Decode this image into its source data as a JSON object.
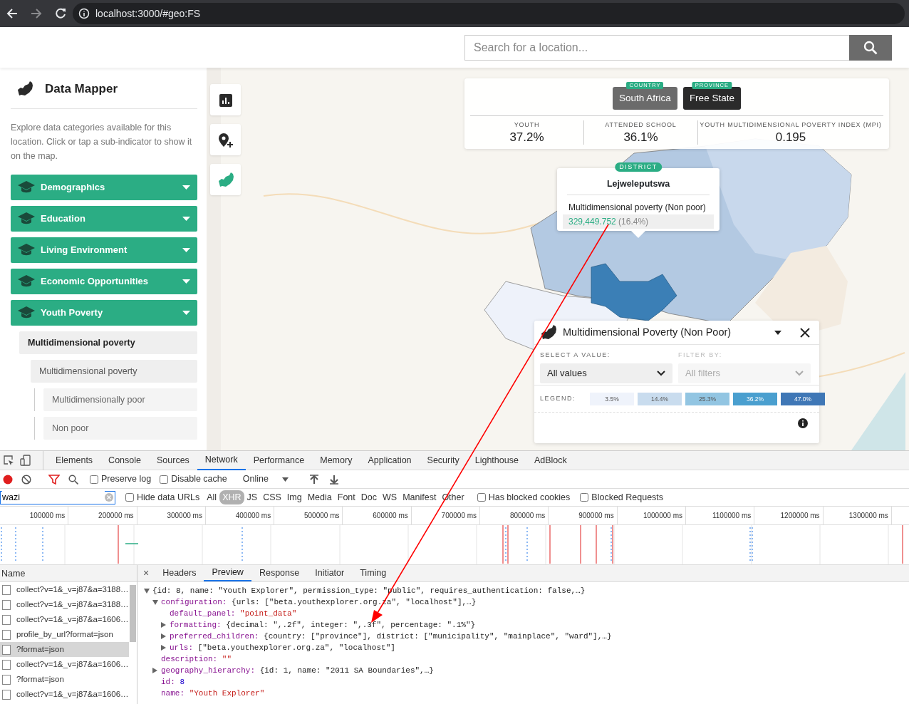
{
  "browser": {
    "url": "localhost:3000/#geo:FS"
  },
  "header": {
    "search_placeholder": "Search for a location..."
  },
  "sidebar": {
    "title": "Data Mapper",
    "description": "Explore data categories available for this location. Click or tap a sub-indicator to show it on the map.",
    "categories": [
      {
        "label": "Demographics"
      },
      {
        "label": "Education"
      },
      {
        "label": "Living Environment"
      },
      {
        "label": "Economic Opportunities"
      },
      {
        "label": "Youth Poverty"
      }
    ],
    "indicators": [
      {
        "label": "Multidimensional poverty",
        "children": [
          {
            "label": "Multidimensional poverty",
            "children": [
              {
                "label": "Multidimensionally poor"
              },
              {
                "label": "Non poor"
              }
            ]
          }
        ]
      }
    ]
  },
  "location": {
    "levels": [
      {
        "tag": "COUNTRY",
        "name": "South Africa",
        "selected": false
      },
      {
        "tag": "PROVINCE",
        "name": "Free State",
        "selected": true
      }
    ],
    "stats": [
      {
        "label": "YOUTH",
        "value": "37.2%"
      },
      {
        "label": "ATTENDED SCHOOL",
        "value": "36.1%"
      },
      {
        "label": "YOUTH MULTIDIMENSIONAL POVERTY INDEX (MPI)",
        "value": "0.195"
      }
    ]
  },
  "tooltip": {
    "tag": "DISTRICT",
    "name": "Lejweleputswa",
    "indicator": "Multidimensional poverty (Non poor)",
    "value": "329,449.752",
    "percentage": "(16.4%)"
  },
  "panel": {
    "title": "Multidimensional Poverty (Non Poor)",
    "select": {
      "label": "SELECT A VALUE:",
      "value": "All values",
      "disabled": false
    },
    "filter": {
      "label": "FILTER BY:",
      "value": "All filters",
      "disabled": true
    },
    "legend_label": "LEGEND:",
    "legend": [
      {
        "label": "3.5%",
        "color": "#eff3fb"
      },
      {
        "label": "14.4%",
        "color": "#c9dcee"
      },
      {
        "label": "25.3%",
        "color": "#92c5e2"
      },
      {
        "label": "36.2%",
        "color": "#4a9fcf"
      },
      {
        "label": "47.0%",
        "color": "#3f77b6"
      }
    ]
  },
  "devtools": {
    "tabs": [
      {
        "label": "Elements",
        "selected": false
      },
      {
        "label": "Console",
        "selected": false
      },
      {
        "label": "Sources",
        "selected": false
      },
      {
        "label": "Network",
        "selected": true
      },
      {
        "label": "Performance",
        "selected": false
      },
      {
        "label": "Memory",
        "selected": false
      },
      {
        "label": "Application",
        "selected": false
      },
      {
        "label": "Security",
        "selected": false
      },
      {
        "label": "Lighthouse",
        "selected": false
      },
      {
        "label": "AdBlock",
        "selected": false
      }
    ],
    "toolbar": {
      "preserve_log": {
        "label": "Preserve log",
        "checked": false
      },
      "disable_cache": {
        "label": "Disable cache",
        "checked": false
      },
      "throttling": "Online"
    },
    "filter": {
      "value": "wazi",
      "hide_data_urls": {
        "label": "Hide data URLs",
        "checked": false
      },
      "types": [
        {
          "label": "All",
          "selected": false
        },
        {
          "label": "XHR",
          "selected": true
        },
        {
          "label": "JS",
          "selected": false
        },
        {
          "label": "CSS",
          "selected": false
        },
        {
          "label": "Img",
          "selected": false
        },
        {
          "label": "Media",
          "selected": false
        },
        {
          "label": "Font",
          "selected": false
        },
        {
          "label": "Doc",
          "selected": false
        },
        {
          "label": "WS",
          "selected": false
        },
        {
          "label": "Manifest",
          "selected": false
        },
        {
          "label": "Other",
          "selected": false
        }
      ],
      "has_blocked_cookies": {
        "label": "Has blocked cookies",
        "checked": false
      },
      "blocked_requests": {
        "label": "Blocked Requests",
        "checked": false
      }
    },
    "timeline_ticks": [
      "100000 ms",
      "200000 ms",
      "300000 ms",
      "400000 ms",
      "500000 ms",
      "600000 ms",
      "700000 ms",
      "800000 ms",
      "900000 ms",
      "1000000 ms",
      "1100000 ms",
      "1200000 ms",
      "1300000 ms"
    ],
    "name_column": "Name",
    "requests": [
      {
        "name": "collect?v=1&_v=j87&a=3188…",
        "selected": false
      },
      {
        "name": "collect?v=1&_v=j87&a=3188…",
        "selected": false
      },
      {
        "name": "collect?v=1&_v=j87&a=1606…",
        "selected": false
      },
      {
        "name": "profile_by_url?format=json",
        "selected": false
      },
      {
        "name": "?format=json",
        "selected": true
      },
      {
        "name": "collect?v=1&_v=j87&a=1606…",
        "selected": false
      },
      {
        "name": "?format=json",
        "selected": false
      },
      {
        "name": "collect?v=1&_v=j87&a=1606…",
        "selected": false
      }
    ],
    "detail_close": "×",
    "detail_tabs": [
      {
        "label": "Headers",
        "selected": false
      },
      {
        "label": "Preview",
        "selected": true
      },
      {
        "label": "Response",
        "selected": false
      },
      {
        "label": "Initiator",
        "selected": false
      },
      {
        "label": "Timing",
        "selected": false
      }
    ],
    "preview": [
      {
        "value": "{id: 8, name: \"Youth Explorer\", permission_type: \"public\", requires_authentication: false,…}",
        "kind": "object",
        "expanded": true,
        "children": [
          {
            "key": "configuration:",
            "value": "{urls: [\"beta.youthexplorer.org.za\", \"localhost\"],…}",
            "kind": "object",
            "expanded": true,
            "children": [
              {
                "key": "default_panel:",
                "value": "\"point_data\"",
                "kind": "string"
              },
              {
                "key": "formatting:",
                "value": "{decimal: \",.2f\", integer: \",.3f\", percentage: \".1%\"}",
                "kind": "object",
                "expanded": false
              },
              {
                "key": "preferred_children:",
                "value": "{country: [\"province\"], district: [\"municipality\", \"mainplace\", \"ward\"],…}",
                "kind": "object",
                "expanded": false
              },
              {
                "key": "urls:",
                "value": "[\"beta.youthexplorer.org.za\", \"localhost\"]",
                "kind": "object",
                "expanded": false
              }
            ]
          },
          {
            "key": "description:",
            "value": "\"\"",
            "kind": "string"
          },
          {
            "key": "geography_hierarchy:",
            "value": "{id: 1, name: \"2011 SA Boundaries\",…}",
            "kind": "object",
            "expanded": false
          },
          {
            "key": "id:",
            "value": "8",
            "kind": "number"
          },
          {
            "key": "name:",
            "value": "\"Youth Explorer\"",
            "kind": "string"
          }
        ]
      }
    ]
  }
}
